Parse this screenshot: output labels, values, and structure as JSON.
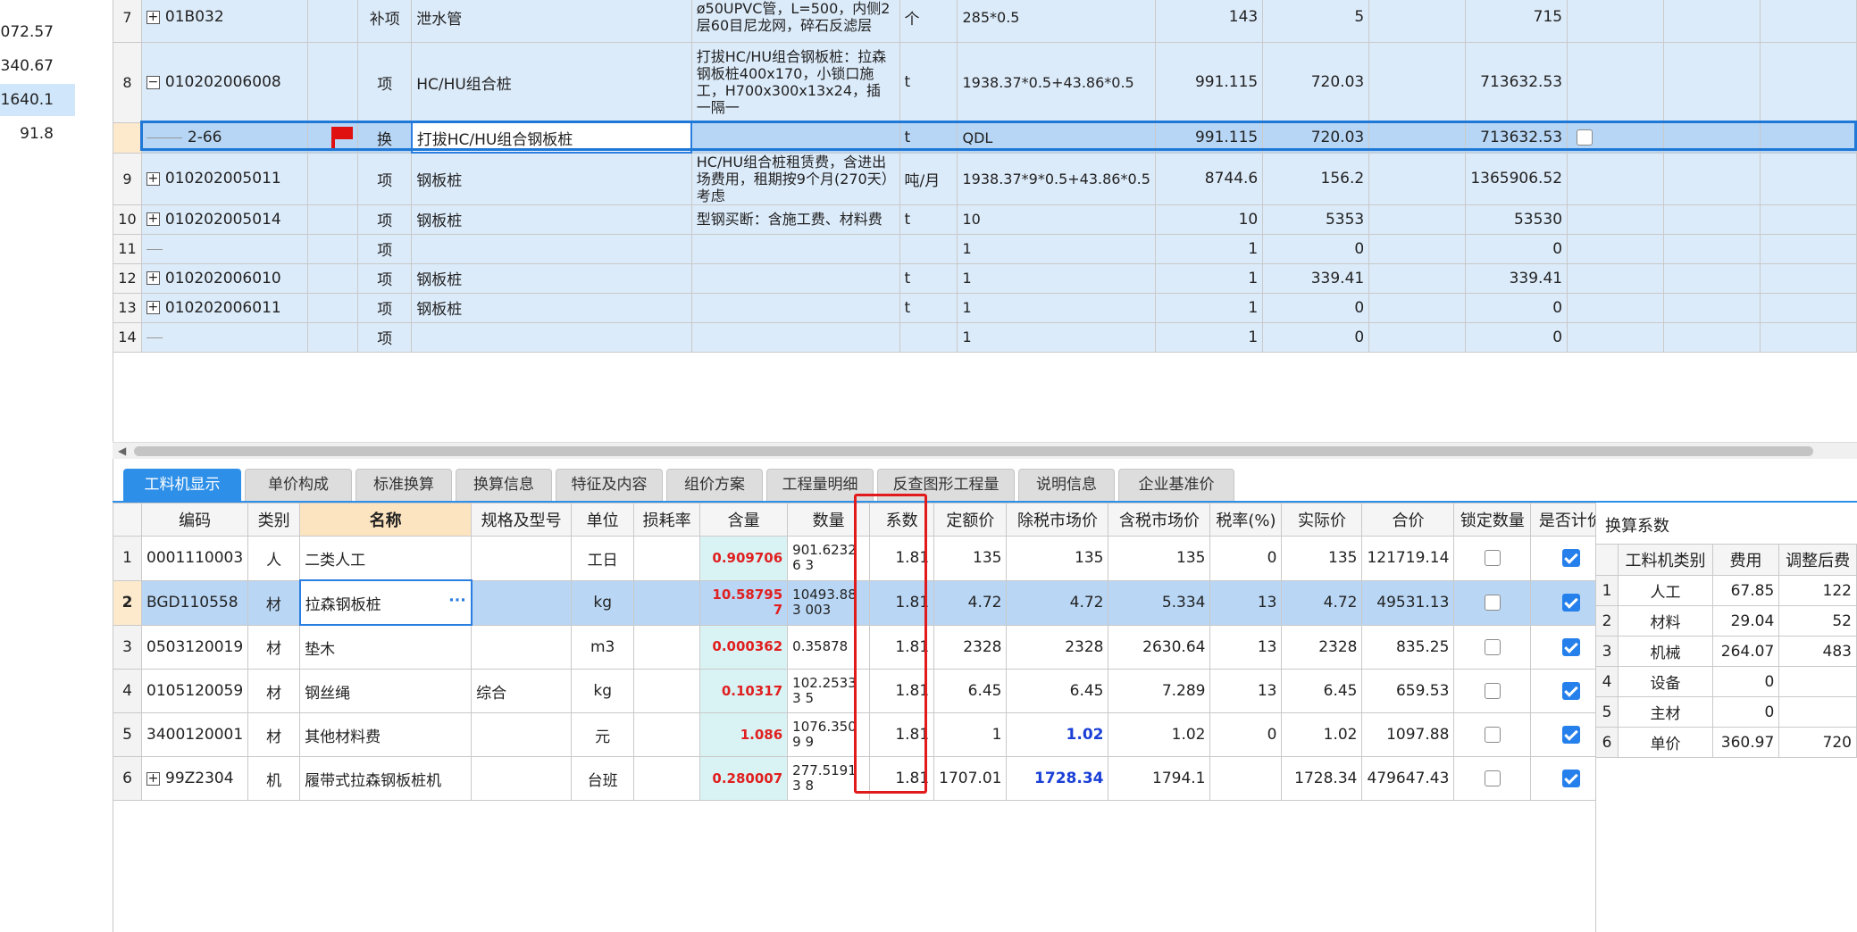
{
  "left_values": [
    "072.57",
    "340.67",
    "1640.1",
    "91.8"
  ],
  "left_selected_index": 2,
  "upper_rows": [
    {
      "rn": "7",
      "code": "01B032",
      "exp": "plus",
      "cat": "补项",
      "name": "泄水管",
      "desc": "ø50UPVC管，L=500，内侧2层60目尼龙网，碎石反滤层",
      "unit": "个",
      "expr": "285*0.5",
      "qty": "143",
      "price": "5",
      "total": "715",
      "cls": "mid"
    },
    {
      "rn": "8",
      "code": "010202006008",
      "exp": "minus",
      "cat": "项",
      "name": "HC/HU组合桩",
      "desc": "打拔HC/HU组合钢板桩：拉森钢板桩400x170，小锁口施工，H700x300x13x24，插一隔一",
      "unit": "t",
      "expr": "1938.37*0.5+43.86*0.5",
      "qty": "991.115",
      "price": "720.03",
      "total": "713632.53",
      "cls": "tall"
    },
    {
      "rn": "",
      "code": "2-66",
      "exp": "sub",
      "cat": "换",
      "name": "打拔HC/HU组合钢板桩",
      "desc": "",
      "unit": "t",
      "expr": "QDL",
      "qty": "991.115",
      "price": "720.03",
      "total": "713632.53",
      "cls": "sel",
      "flag": true,
      "check": true
    },
    {
      "rn": "9",
      "code": "010202005011",
      "exp": "plus",
      "cat": "项",
      "name": "钢板桩",
      "desc": "HC/HU组合桩租赁费，含进出场费用，租期按9个月(270天）考虑",
      "unit": "吨/月",
      "expr": "1938.37*9*0.5+43.86*0.5",
      "qty": "8744.6",
      "price": "156.2",
      "total": "1365906.52",
      "cls": "tall2"
    },
    {
      "rn": "10",
      "code": "010202005014",
      "exp": "plus",
      "cat": "项",
      "name": "钢板桩",
      "desc": "型钢买断：含施工费、材料费",
      "unit": "t",
      "expr": "10",
      "qty": "10",
      "price": "5353",
      "total": "53530",
      "cls": ""
    },
    {
      "rn": "11",
      "code": "",
      "exp": "line",
      "cat": "项",
      "name": "",
      "desc": "",
      "unit": "",
      "expr": "1",
      "qty": "1",
      "price": "0",
      "total": "0",
      "cls": ""
    },
    {
      "rn": "12",
      "code": "010202006010",
      "exp": "plus",
      "cat": "项",
      "name": "钢板桩",
      "desc": "",
      "unit": "t",
      "expr": "1",
      "qty": "1",
      "price": "339.41",
      "total": "339.41",
      "cls": ""
    },
    {
      "rn": "13",
      "code": "010202006011",
      "exp": "plus",
      "cat": "项",
      "name": "钢板桩",
      "desc": "",
      "unit": "t",
      "expr": "1",
      "qty": "1",
      "price": "0",
      "total": "0",
      "cls": ""
    },
    {
      "rn": "14",
      "code": "",
      "exp": "line",
      "cat": "项",
      "name": "",
      "desc": "",
      "unit": "",
      "expr": "1",
      "qty": "1",
      "price": "0",
      "total": "0",
      "cls": ""
    }
  ],
  "tabs": [
    "工料机显示",
    "单价构成",
    "标准换算",
    "换算信息",
    "特征及内容",
    "组价方案",
    "工程量明细",
    "反查图形工程量",
    "说明信息",
    "企业基准价"
  ],
  "lower_headers": [
    "",
    "编码",
    "类别",
    "名称",
    "规格及型号",
    "单位",
    "损耗率",
    "含量",
    "数量",
    "系数",
    "定额价",
    "除税市场价",
    "含税市场价",
    "税率(%)",
    "实际价",
    "合价",
    "锁定数量",
    "是否计价"
  ],
  "lower_rows": [
    {
      "rn": "1",
      "code": "0001110003",
      "cat": "人",
      "name": "二类人工",
      "spec": "",
      "unit": "工日",
      "loss": "",
      "content": "0.909706",
      "qty": "901.62326\n3",
      "coef": "1.81",
      "quota": "135",
      "market": "135",
      "taxmarket": "135",
      "rate": "0",
      "actual": "135",
      "total": "121719.14",
      "blue": false
    },
    {
      "rn": "2",
      "code": "BGD110558",
      "cat": "材",
      "name": "拉森钢板桩",
      "spec": "",
      "unit": "kg",
      "loss": "",
      "content": "10.58795\n7",
      "qty": "10493.883\n003",
      "coef": "1.81",
      "quota": "4.72",
      "market": "4.72",
      "taxmarket": "5.334",
      "rate": "13",
      "actual": "4.72",
      "total": "49531.13",
      "blue": false,
      "sel": true
    },
    {
      "rn": "3",
      "code": "0503120019",
      "cat": "材",
      "name": "垫木",
      "spec": "",
      "unit": "m3",
      "loss": "",
      "content": "0.000362",
      "qty": "0.35878",
      "coef": "1.81",
      "quota": "2328",
      "market": "2328",
      "taxmarket": "2630.64",
      "rate": "13",
      "actual": "2328",
      "total": "835.25",
      "blue": false
    },
    {
      "rn": "4",
      "code": "0105120059",
      "cat": "材",
      "name": "钢丝绳",
      "spec": "综合",
      "unit": "kg",
      "loss": "",
      "content": "0.10317",
      "qty": "102.25333\n5",
      "coef": "1.81",
      "quota": "6.45",
      "market": "6.45",
      "taxmarket": "7.289",
      "rate": "13",
      "actual": "6.45",
      "total": "659.53",
      "blue": false
    },
    {
      "rn": "5",
      "code": "3400120001",
      "cat": "材",
      "name": "其他材料费",
      "spec": "",
      "unit": "元",
      "loss": "",
      "content": "1.086",
      "qty": "1076.3509\n9",
      "coef": "1.81",
      "quota": "1",
      "market": "1.02",
      "taxmarket": "1.02",
      "rate": "0",
      "actual": "1.02",
      "total": "1097.88",
      "blue": true
    },
    {
      "rn": "6",
      "code": "99Z2304",
      "cat": "机",
      "name": "履带式拉森钢板桩机",
      "spec": "",
      "unit": "台班",
      "loss": "",
      "content": "0.280007",
      "qty": "277.51913\n8",
      "coef": "1.81",
      "quota": "1707.01",
      "market": "1728.34",
      "taxmarket": "1794.1",
      "rate": "",
      "actual": "1728.34",
      "total": "479647.43",
      "blue": true,
      "plus": true
    }
  ],
  "coef_panel": {
    "title": "换算系数",
    "headers": [
      "",
      "工料机类别",
      "费用",
      "调整后费"
    ],
    "rows": [
      {
        "rn": "1",
        "cat": "人工",
        "fee": "67.85",
        "adj": "122"
      },
      {
        "rn": "2",
        "cat": "材料",
        "fee": "29.04",
        "adj": "52"
      },
      {
        "rn": "3",
        "cat": "机械",
        "fee": "264.07",
        "adj": "483"
      },
      {
        "rn": "4",
        "cat": "设备",
        "fee": "0",
        "adj": ""
      },
      {
        "rn": "5",
        "cat": "主材",
        "fee": "0",
        "adj": ""
      },
      {
        "rn": "6",
        "cat": "单价",
        "fee": "360.97",
        "adj": "720"
      }
    ]
  },
  "colors": {
    "accent": "#2e8fe8",
    "highlight_box": "#e11b1b",
    "content_text": "#e02020",
    "row_bg": "#dcebfa"
  }
}
